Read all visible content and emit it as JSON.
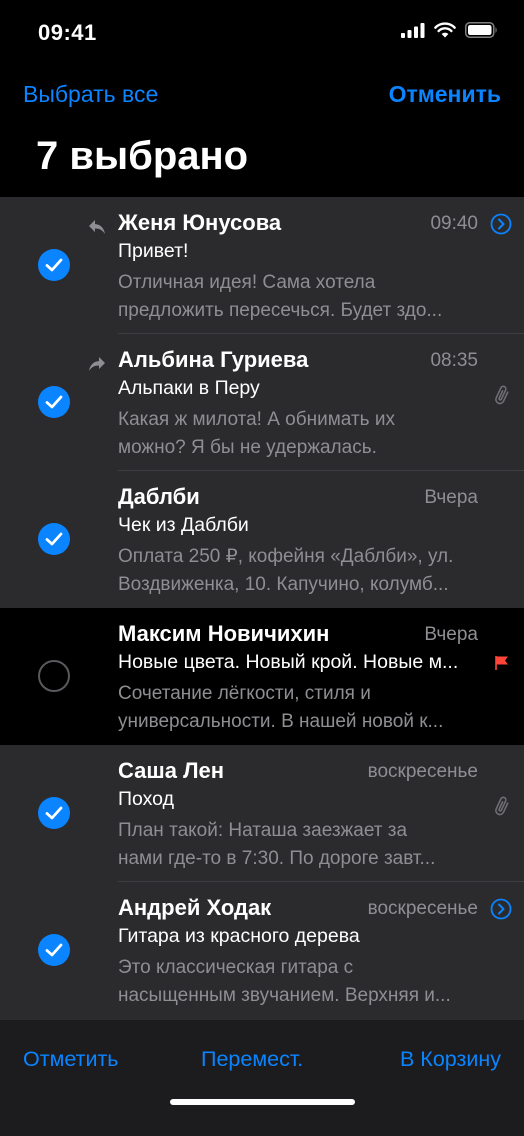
{
  "status_bar": {
    "time": "09:41"
  },
  "nav": {
    "select_all": "Выбрать все",
    "cancel": "Отменить"
  },
  "title": "7 выбрано",
  "colors": {
    "accent": "#0a84ff",
    "flag": "#ff453a",
    "row_selected_bg": "#2b2b2e",
    "secondary_text": "#8e8e93"
  },
  "messages": [
    {
      "sender": "Женя Юнусова",
      "time": "09:40",
      "subject": "Привет!",
      "preview_1": "Отличная идея! Сама хотела",
      "preview_2": "предложить пересечься. Будет здо...",
      "selected": true,
      "status_icon": "reply-arrow-icon",
      "trailing_icon": "chevron-circle-icon"
    },
    {
      "sender": "Альбина Гуриева",
      "time": "08:35",
      "subject": "Альпаки в Перу",
      "preview_1": "Какая ж милота! А обнимать их",
      "preview_2": "можно? Я бы не удержалась.",
      "selected": true,
      "status_icon": "forward-arrow-icon",
      "side_icon": "paperclip-icon"
    },
    {
      "sender": "Даблби",
      "time": "Вчера",
      "subject": "Чек из Даблби",
      "preview_1": "Оплата 250 ₽, кофейня «Даблби», ул.",
      "preview_2": "Воздвиженка, 10. Капучино, колумб...",
      "selected": true
    },
    {
      "sender": "Максим Новичихин",
      "time": "Вчера",
      "subject": "Новые цвета. Новый крой. Новые м...",
      "preview_1": "Сочетание лёгкости, стиля и",
      "preview_2": "универсальности. В нашей новой к...",
      "selected": false,
      "side_icon": "flag-icon"
    },
    {
      "sender": "Саша Лен",
      "time": "воскресенье",
      "subject": "Поход",
      "preview_1": "План такой: Наташа заезжает за",
      "preview_2": "нами где-то в 7:30. По дороге завт...",
      "selected": true,
      "side_icon": "paperclip-icon"
    },
    {
      "sender": "Андрей Ходак",
      "time": "воскресенье",
      "subject": "Гитара из красного дерева",
      "preview_1": "Это классическая гитара с",
      "preview_2": "насыщенным звучанием. Верхняя и...",
      "selected": true,
      "trailing_icon": "chevron-circle-icon"
    }
  ],
  "toolbar": {
    "mark": "Отметить",
    "move": "Перемест.",
    "trash": "В Корзину"
  }
}
